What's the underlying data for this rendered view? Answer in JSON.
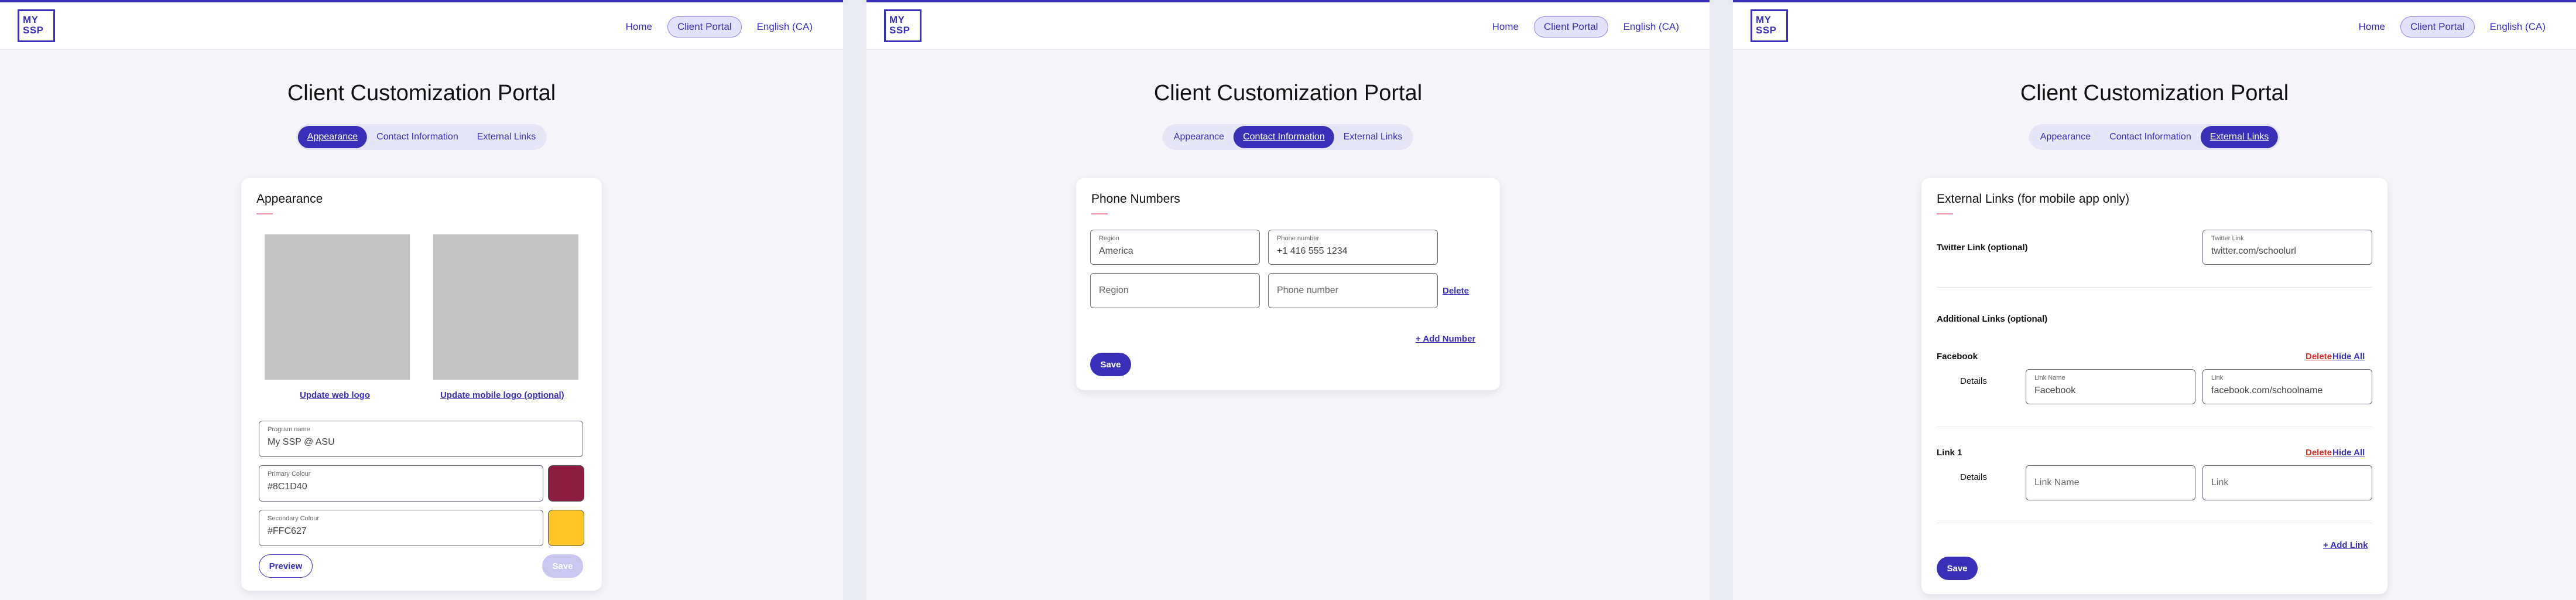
{
  "logo": {
    "line1": "MY",
    "line2": "SSP"
  },
  "nav": {
    "home": "Home",
    "client_portal": "Client Portal",
    "language": "English (CA)"
  },
  "page_title": "Client Customization Portal",
  "tabs": {
    "appearance": "Appearance",
    "contact": "Contact Information",
    "external": "External Links"
  },
  "appearance": {
    "title": "Appearance",
    "update_web_logo": "Update web logo",
    "update_mobile_logo": "Update mobile logo (optional)",
    "program_name": {
      "label": "Program name",
      "value": "My SSP @ ASU"
    },
    "primary_colour": {
      "label": "Primary Colour",
      "value": "#8C1D40"
    },
    "secondary_colour": {
      "label": "Secondary Colour",
      "value": "#FFC627"
    },
    "preview": "Preview",
    "save": "Save"
  },
  "contact": {
    "title": "Phone Numbers",
    "rows": [
      {
        "region_label": "Region",
        "region_value": "America",
        "phone_label": "Phone number",
        "phone_value": "+1 416 555 1234"
      },
      {
        "region_placeholder": "Region",
        "phone_placeholder": "Phone number",
        "delete": "Delete"
      }
    ],
    "add_number": "+ Add Number",
    "save": "Save"
  },
  "external": {
    "title": "External Links (for mobile app only)",
    "twitter": {
      "label": "Twitter Link (optional)",
      "field_label": "Twitter Link",
      "value": "twitter.com/schoolurl"
    },
    "additional": "Additional Links (optional)",
    "facebook": {
      "name": "Facebook",
      "delete": "Delete",
      "hide_all": "Hide All",
      "details": "Details",
      "link_name_label": "Link Name",
      "link_name_value": "Facebook",
      "link_label": "Link",
      "link_value": "facebook.com/schoolname"
    },
    "link1": {
      "name": "Link 1",
      "delete": "Delete",
      "hide_all": "Hide All",
      "details": "Details",
      "link_name_placeholder": "Link Name",
      "link_placeholder": "Link"
    },
    "add_link": "+ Add Link",
    "save": "Save"
  },
  "colors": {
    "accent": "#3a2fb8",
    "primary_swatch": "#8C1D40",
    "secondary_swatch": "#FFC627",
    "delete": "#d0332b"
  }
}
